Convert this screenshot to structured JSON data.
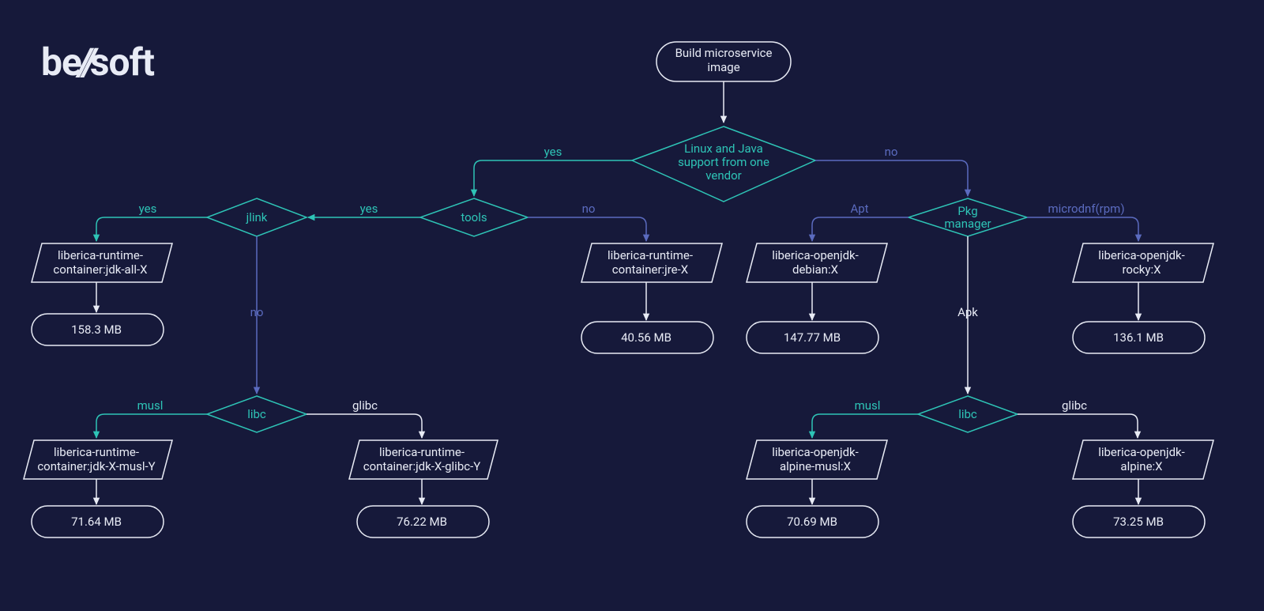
{
  "brand": "be//soft",
  "nodes": {
    "start": "Build microservice image",
    "d_vendor": "Linux and Java support from one vendor",
    "d_tools": "tools",
    "d_jlink": "jlink",
    "d_pkg": "Pkg manager",
    "d_libc_left": "libc",
    "d_libc_right": "libc",
    "b_jdk_all": "liberica-runtime-container:jdk-all-X",
    "s_jdk_all": "158.3 MB",
    "b_jre": "liberica-runtime-container:jre-X",
    "s_jre": "40.56 MB",
    "b_debian": "liberica-openjdk-debian:X",
    "s_debian": "147.77 MB",
    "b_rocky": "liberica-openjdk-rocky:X",
    "s_rocky": "136.1 MB",
    "b_musl": "liberica-runtime-container:jdk-X-musl-Y",
    "s_musl": "71.64 MB",
    "b_glibc": "liberica-runtime-container:jdk-X-glibc-Y",
    "s_glibc": "76.22 MB",
    "b_alpine_musl": "liberica-openjdk-alpine-musl:X",
    "s_alpine_musl": "70.69 MB",
    "b_alpine": "liberica-openjdk-alpine:X",
    "s_alpine": "73.25 MB"
  },
  "edges": {
    "yes": "yes",
    "no": "no",
    "apt": "Apt",
    "rpm": "microdnf(rpm)",
    "apk": "Apk",
    "musl": "musl",
    "glibc": "glibc"
  },
  "colors": {
    "bg": "#16193a",
    "teal": "#2ec4b6",
    "blue": "#5b6bbf",
    "fg": "#e8ebf5"
  }
}
